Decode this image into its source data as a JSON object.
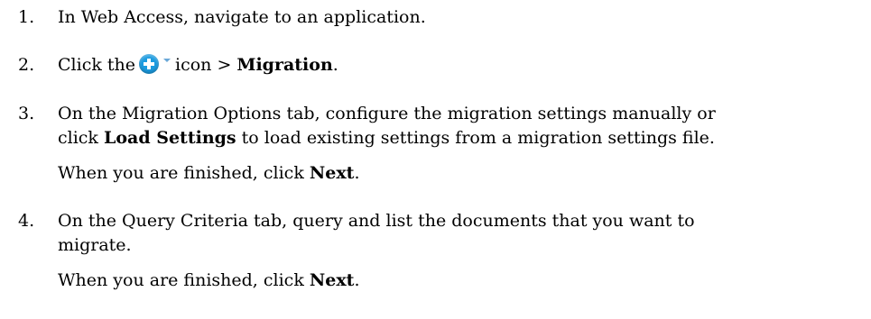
{
  "steps": [
    {
      "number": "1.",
      "text": "In Web Access, navigate to an application."
    },
    {
      "number": "2.",
      "before_icon": "Click the",
      "icon": "add-icon",
      "icon_color": "#1b9be0",
      "after_icon": "icon >",
      "bold": "Migration",
      "end": "."
    },
    {
      "number": "3.",
      "line1": "On the Migration Options tab, configure the migration settings manually or",
      "line2_before": "click",
      "line2_bold": "Load Settings",
      "line2_after": "to load existing settings from a migration settings file.",
      "note_before": "When you are finished, click",
      "note_bold": "Next",
      "note_end": "."
    },
    {
      "number": "4.",
      "line1": "On the Query Criteria tab, query and list the documents that you want to",
      "line2": "migrate.",
      "note_before": "When you are finished, click",
      "note_bold": "Next",
      "note_end": "."
    }
  ]
}
